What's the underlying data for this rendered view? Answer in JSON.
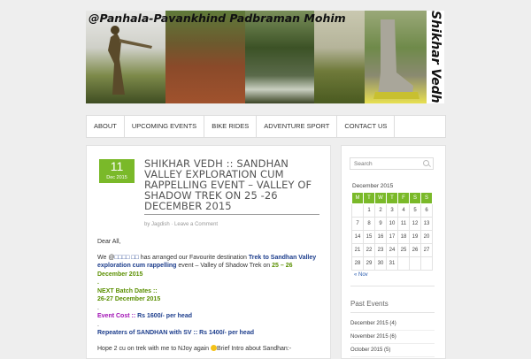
{
  "header": {
    "banner_caption": "@Panhala-Pavankhind Padbraman Mohim",
    "side_title": "Shikhar Vedh"
  },
  "nav": {
    "items": [
      "ABOUT",
      "UPCOMING EVENTS",
      "BIKE RIDES",
      "ADVENTURE SPORT",
      "CONTACT US"
    ]
  },
  "post": {
    "date_day": "11",
    "date_month": "Dec 2015",
    "title": "SHIKHAR VEDH :: SANDHAN VALLEY EXPLORATION CUM RAPPELLING EVENT – VALLEY OF SHADOW TREK ON 25 -26 DECEMBER 2015",
    "meta_prefix": "by",
    "author": "Jagdish",
    "meta_sep": "·",
    "comment_link": "Leave a Comment",
    "greeting": "Dear All,",
    "intro_1": "We @",
    "intro_boxes": "□□□□ □□",
    "intro_2": " has arranged our Favourite destination ",
    "intro_bold": "Trek to Sandhan Valley exploration cum rappelling",
    "intro_3": " event – Valley of Shadow Trek on ",
    "intro_date": "25 – 26 December 2015",
    "dot1": ".",
    "batch_label": "NEXT Batch Dates ::",
    "batch_dates": "26-27 December 2015",
    "dot2": ".",
    "cost_label": "Event Cost :: ",
    "cost_value": "Rs 1600/- per head",
    "dot3": ".",
    "repeaters": "Repeaters of SANDHAN with SV :: Rs 1400/- per head",
    "hope_1": "Hope 2 cu on trek with me to NJoy again ",
    "hope_2": "Brief Intro about Sandhan:-"
  },
  "sidebar": {
    "search_placeholder": "Search",
    "calendar_caption": "December 2015",
    "weekdays": [
      "M",
      "T",
      "W",
      "T",
      "F",
      "S",
      "S"
    ],
    "weeks": [
      [
        "",
        "1",
        "2",
        "3",
        "4",
        "5",
        "6"
      ],
      [
        "7",
        "8",
        "9",
        "10",
        "11",
        "12",
        "13"
      ],
      [
        "14",
        "15",
        "16",
        "17",
        "18",
        "19",
        "20"
      ],
      [
        "21",
        "22",
        "23",
        "24",
        "25",
        "26",
        "27"
      ],
      [
        "28",
        "29",
        "30",
        "31",
        "",
        "",
        ""
      ]
    ],
    "prev_month": "« Nov",
    "past_events_title": "Past Events",
    "archives": [
      "December 2015 (4)",
      "November 2015 (6)",
      "October 2015 (5)"
    ]
  },
  "colors": {
    "accent_green": "#7ab929",
    "link_navy": "#1c3d8c",
    "purple": "#a112b5"
  }
}
